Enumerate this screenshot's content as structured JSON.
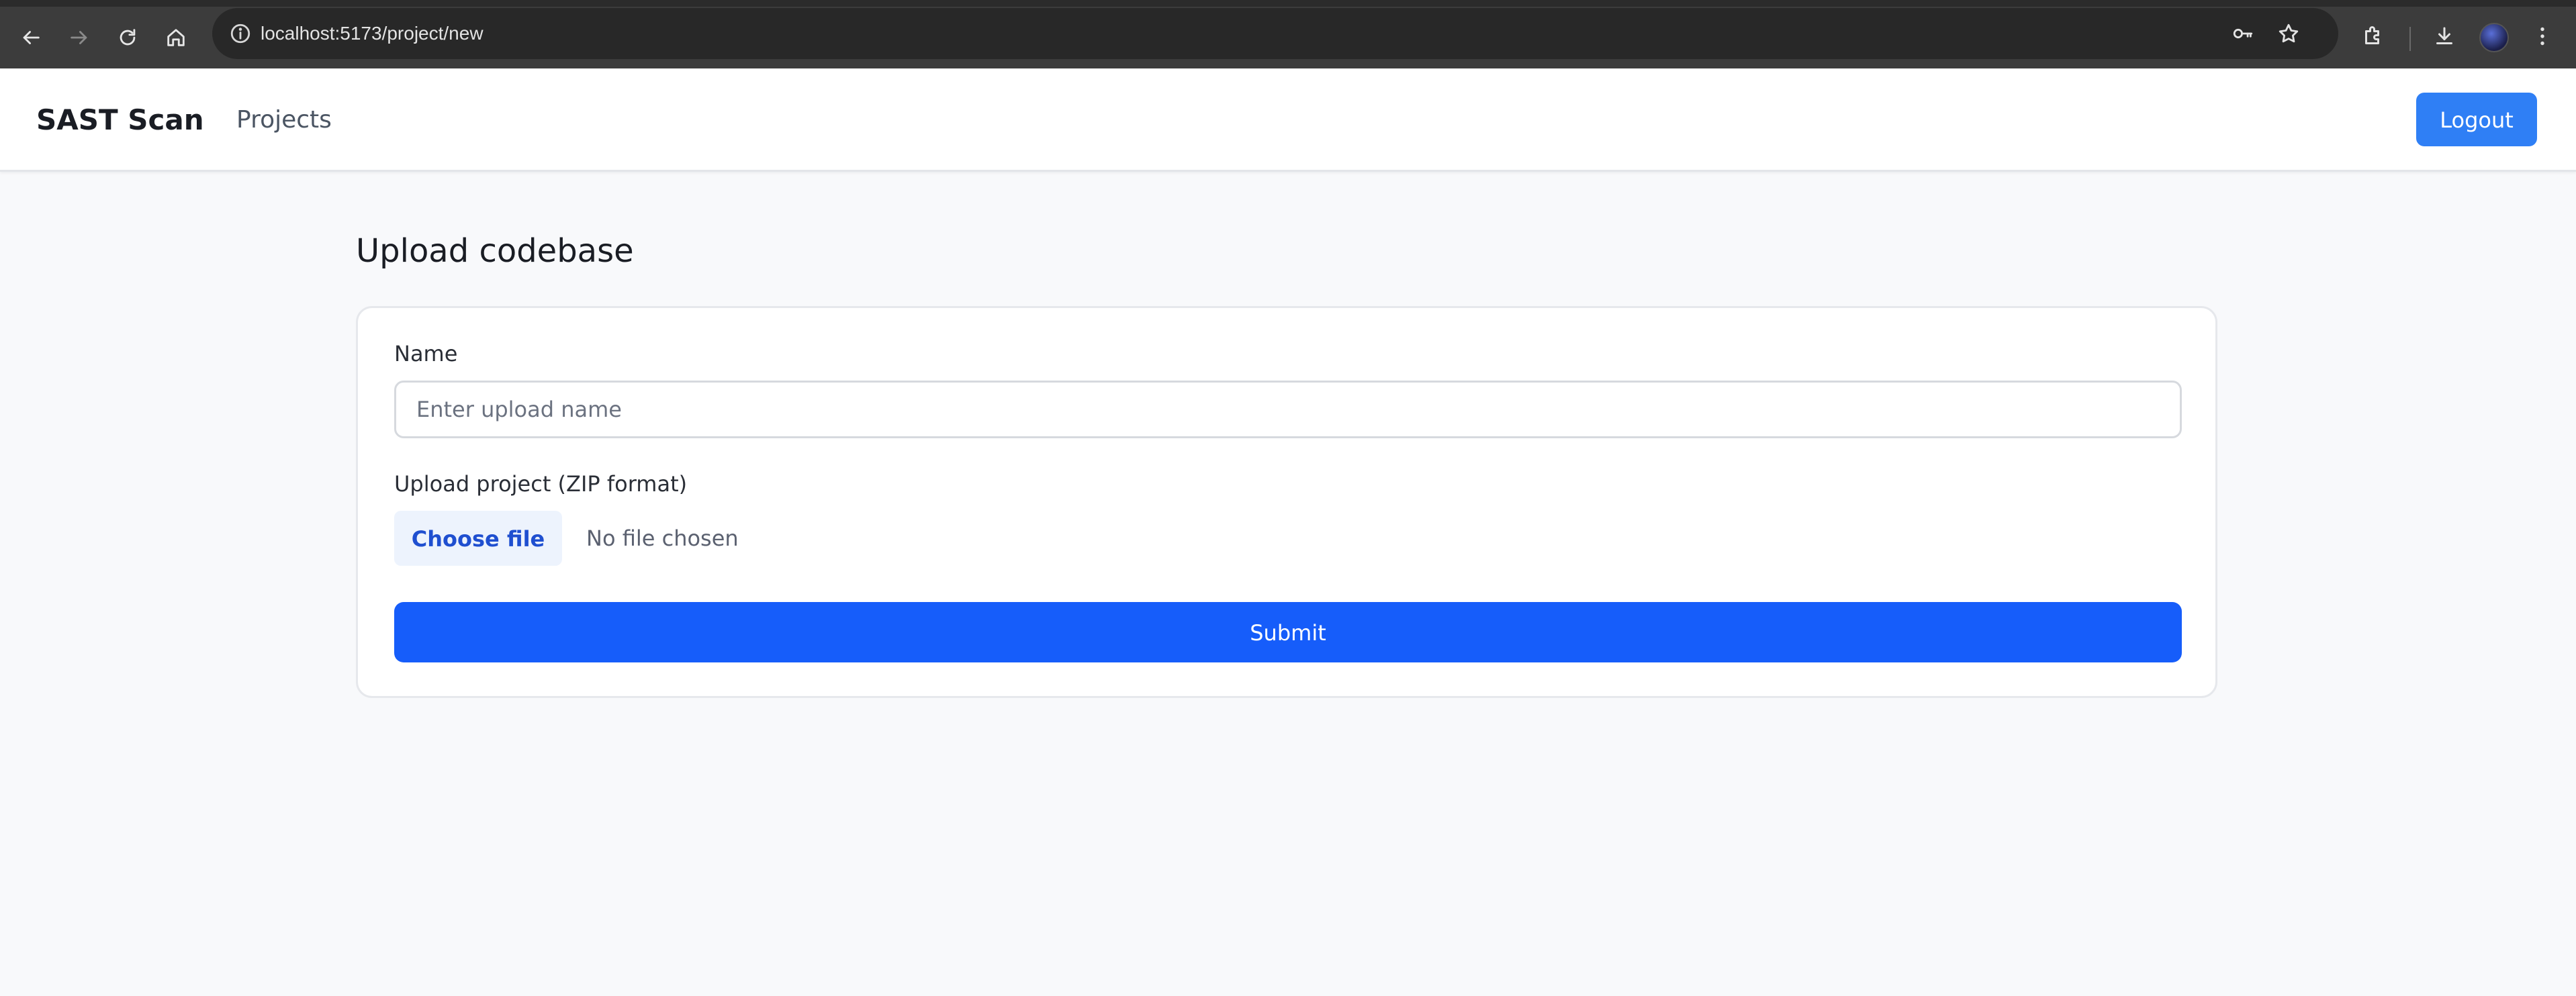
{
  "browser": {
    "url": "localhost:5173/project/new",
    "icons": {
      "back": "back-arrow-icon",
      "forward": "forward-arrow-icon",
      "reload": "reload-icon",
      "home": "home-icon",
      "site_info": "info-icon",
      "password": "key-icon",
      "bookmark": "star-icon",
      "extensions": "puzzle-icon",
      "downloads": "download-icon",
      "menu": "kebab-menu-icon"
    }
  },
  "header": {
    "brand": "SAST Scan",
    "nav": [
      {
        "label": "Projects"
      }
    ],
    "logout_label": "Logout"
  },
  "main": {
    "title": "Upload codebase",
    "form": {
      "name_label": "Name",
      "name_value": "",
      "name_placeholder": "Enter upload name",
      "upload_label": "Upload project (ZIP format)",
      "choose_file_label": "Choose file",
      "file_status": "No file chosen",
      "submit_label": "Submit"
    }
  },
  "colors": {
    "primary": "#165dfa",
    "logout": "#2f7ff5",
    "file_button_bg": "#edf3fd",
    "file_button_text": "#1f4fd0",
    "page_bg": "#f8f9fb"
  }
}
